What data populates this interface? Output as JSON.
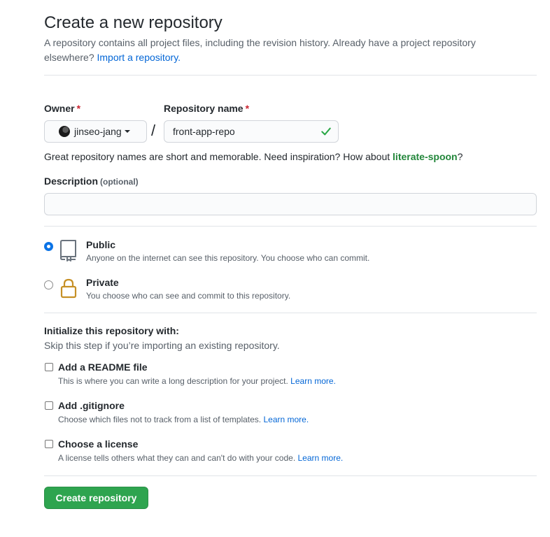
{
  "header": {
    "title": "Create a new repository",
    "intro_line1": "A repository contains all project files, including the revision history. Already have a project repository",
    "intro_line2": "elsewhere?",
    "import_link": "Import a repository."
  },
  "owner": {
    "label": "Owner",
    "required_mark": "*",
    "value": "jinseo-jang"
  },
  "separator": "/",
  "repo_name": {
    "label": "Repository name",
    "required_mark": "*",
    "value": "front-app-repo"
  },
  "hint": {
    "text": "Great repository names are short and memorable. Need inspiration? How about",
    "suggestion": "literate-spoon",
    "end": "?"
  },
  "description": {
    "label": "Description",
    "optional": "(optional)",
    "value": ""
  },
  "visibility": [
    {
      "title": "Public",
      "subtitle": "Anyone on the internet can see this repository. You choose who can commit.",
      "selected": true
    },
    {
      "title": "Private",
      "subtitle": "You choose who can see and commit to this repository.",
      "selected": false
    }
  ],
  "initialize": {
    "title": "Initialize this repository with:",
    "subtitle": "Skip this step if you’re importing an existing repository.",
    "options": [
      {
        "title": "Add a README file",
        "desc": "This is where you can write a long description for your project.",
        "link": "Learn more.",
        "checked": false
      },
      {
        "title": "Add .gitignore",
        "desc": "Choose which files not to track from a list of templates.",
        "link": "Learn more.",
        "checked": false
      },
      {
        "title": "Choose a license",
        "desc": "A license tells others what they can and can't do with your code.",
        "link": "Learn more.",
        "checked": false
      }
    ]
  },
  "submit_label": "Create repository",
  "colors": {
    "accent_blue": "#0366d6",
    "success_green": "#2ea44f",
    "suggestion_green": "#22863a",
    "required_red": "#cb2431",
    "lock_gold": "#c69026"
  }
}
